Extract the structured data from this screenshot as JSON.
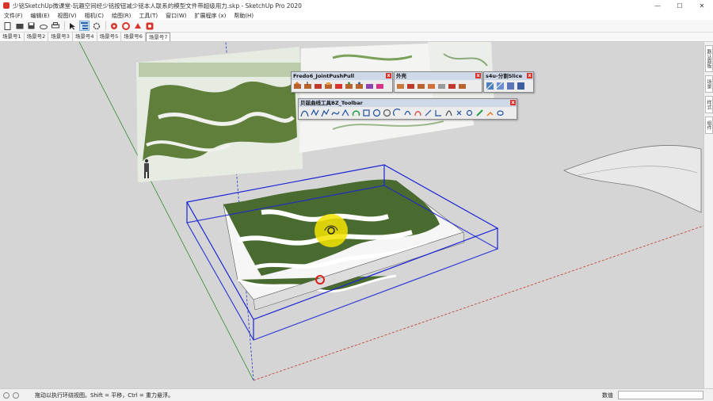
{
  "window": {
    "title": "少铭SketchUp微课堂-玩趣空间经少铭按钮减少铭本人联系的模型文件带超级用力.skp - SketchUp Pro 2020",
    "minimize": "—",
    "maximize": "☐",
    "close": "✕"
  },
  "menu": [
    "文件(F)",
    "编辑(E)",
    "视图(V)",
    "相机(C)",
    "绘图(R)",
    "工具(T)",
    "窗口(W)",
    "扩展程序 (x)",
    "帮助(H)"
  ],
  "scenes": [
    "场景号1",
    "场景号2",
    "场景号3",
    "场景号4",
    "场景号5",
    "场景号6",
    "场景号7"
  ],
  "active_scene_index": 6,
  "toolbars": {
    "fredo": {
      "title": "Fredo6_JointPushPull",
      "close": "x"
    },
    "shell": {
      "title": "外壳",
      "close": "x"
    },
    "slice": {
      "title": "s4u-分割Slice",
      "close": "x"
    },
    "curves": {
      "title": "贝兹曲线工具BZ_Toolbar",
      "close": "x"
    }
  },
  "right_panel_tabs": [
    "默认面板",
    "场景",
    "样式",
    "组件"
  ],
  "status": {
    "hint": "拖动以执行环绕视图。Shift = 平移，Ctrl = 重力悬浮。",
    "vcb_label": "数值",
    "vcb_value": ""
  },
  "colors": {
    "viewport_bg": "#d5d5d5",
    "selection_box": "#1a23d6",
    "terrain_green": "#4a6b2f",
    "axis_red": "#c0392b",
    "axis_green": "#2e8b2e",
    "axis_blue": "#2a3cc8"
  }
}
